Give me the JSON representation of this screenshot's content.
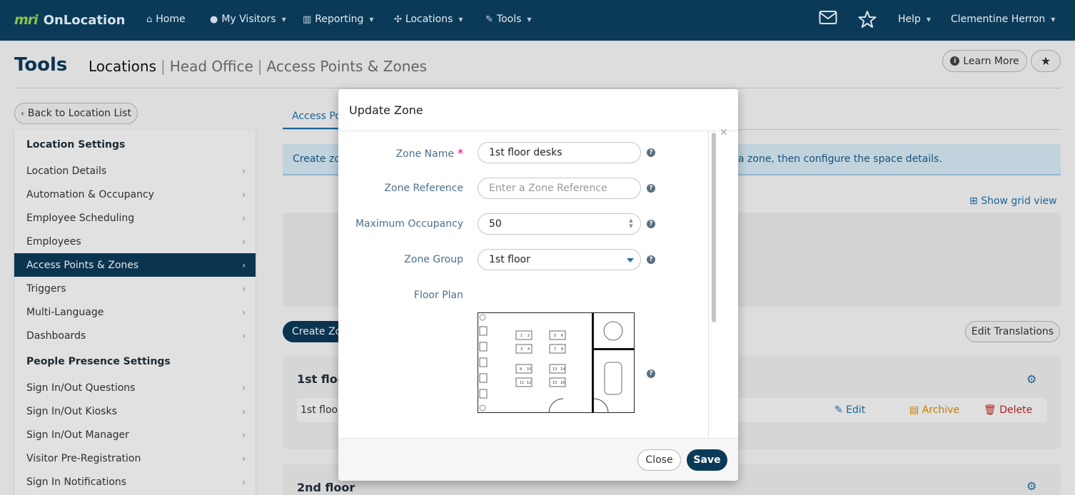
{
  "nav": {
    "logo_mark": "mri",
    "app_name": "OnLocation",
    "items": [
      {
        "label": "Home",
        "icon": "home-icon"
      },
      {
        "label": "My Visitors",
        "icon": "user-icon"
      },
      {
        "label": "Reporting",
        "icon": "bar-chart-icon"
      },
      {
        "label": "Locations",
        "icon": "network-icon"
      },
      {
        "label": "Tools",
        "icon": "wrench-icon"
      }
    ],
    "help_label": "Help",
    "user_name": "Clementine Herron"
  },
  "header": {
    "title": "Tools",
    "breadcrumb": [
      "Locations",
      "Head Office",
      "Access Points & Zones"
    ],
    "learn_more": "Learn More"
  },
  "back_button": "Back to Location List",
  "sidebar": {
    "section1": "Location Settings",
    "items1": [
      "Location Details",
      "Automation & Occupancy",
      "Employee Scheduling",
      "Employees",
      "Access Points & Zones",
      "Triggers",
      "Multi-Language",
      "Dashboards"
    ],
    "active_index": 4,
    "section2": "People Presence Settings",
    "items2": [
      "Sign In/Out Questions",
      "Sign In/Out Kiosks",
      "Sign In/Out Manager",
      "Visitor Pre-Registration",
      "Sign In Notifications"
    ]
  },
  "main": {
    "tab_label": "Access Po",
    "info_left": "Create zo",
    "info_right": "a zone, then configure the space details.",
    "grid_view": "Show grid view",
    "create_button": "Create Zo",
    "edit_translations": "Edit Translations",
    "zones": [
      {
        "title": "1st floo",
        "row": "1st floo"
      },
      {
        "title": "2nd floor"
      }
    ],
    "actions": {
      "edit": "Edit",
      "archive": "Archive",
      "delete": "Delete"
    }
  },
  "modal": {
    "title": "Update Zone",
    "fields": {
      "zone_name_label": "Zone Name",
      "zone_name_value": "1st floor desks",
      "zone_ref_label": "Zone Reference",
      "zone_ref_placeholder": "Enter a Zone Reference",
      "max_occ_label": "Maximum Occupancy",
      "max_occ_value": "50",
      "zone_group_label": "Zone Group",
      "zone_group_value": "1st floor",
      "floor_plan_label": "Floor Plan"
    },
    "close": "Close",
    "save": "Save"
  },
  "colors": {
    "nav_bg": "#0b3a58",
    "link": "#1e6fa6",
    "required": "#d6006f",
    "archive": "#d88a00",
    "delete": "#c42222"
  }
}
